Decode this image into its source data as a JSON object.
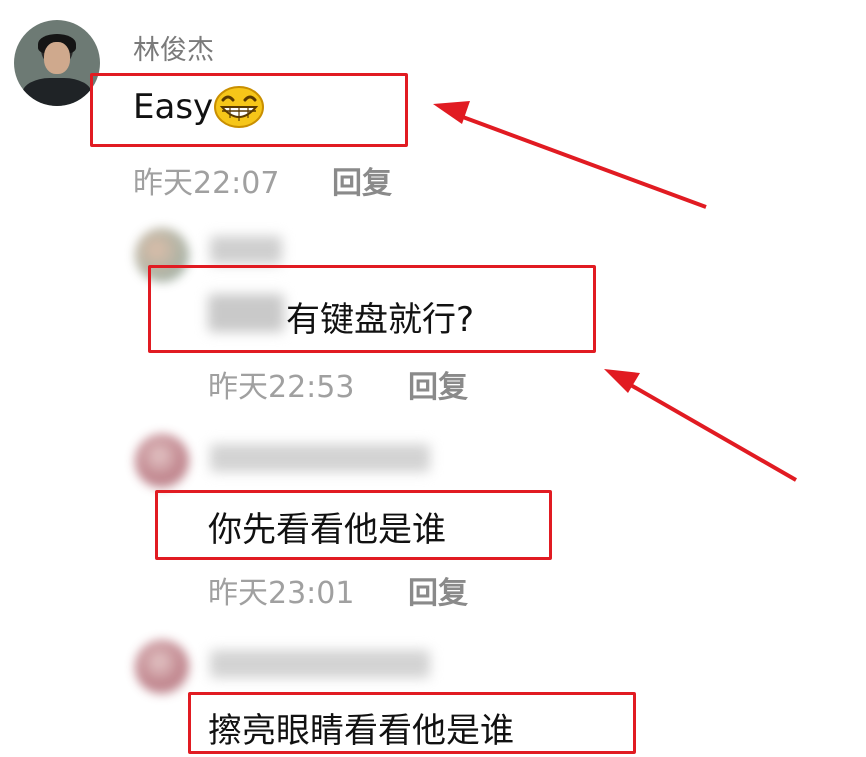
{
  "comments": [
    {
      "username": "林俊杰",
      "message": "Easy",
      "emoji": "grinning-face-emoji",
      "time": "昨天22:07",
      "reply_label": "回复"
    },
    {
      "username_blurred": "",
      "message_blurred_prefix": "",
      "message": "有键盘就行?",
      "time": "昨天22:53",
      "reply_label": "回复"
    },
    {
      "username_blurred": "",
      "message": "你先看看他是谁",
      "time": "昨天23:01",
      "reply_label": "回复"
    },
    {
      "username_blurred": "",
      "message": "擦亮眼睛看看他是谁"
    }
  ],
  "colors": {
    "highlight_box": "#e11b22",
    "arrow": "#e11b22",
    "meta_text": "#a0a0a0",
    "username_text": "#7a7a7a"
  }
}
